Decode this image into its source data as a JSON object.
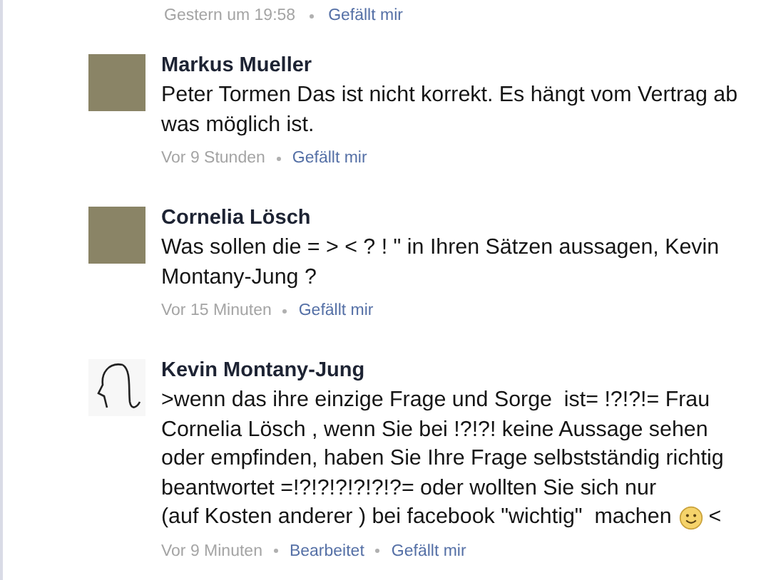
{
  "previous_meta": {
    "time": "Gestern um 19:58",
    "actions": [
      "Gefällt mir"
    ]
  },
  "comments": [
    {
      "author": "Markus Mueller",
      "avatar": {
        "kind": "photo"
      },
      "body": [
        [
          {
            "kind": "text",
            "text": "Peter Tormen Das ist nicht korrekt. Es hängt vom Vertrag ab was möglich ist."
          }
        ]
      ],
      "time": "Vor 9 Stunden",
      "actions": [
        "Gefällt mir"
      ]
    },
    {
      "author": "Cornelia Lösch",
      "avatar": {
        "kind": "photo"
      },
      "body": [
        [
          {
            "kind": "text",
            "text": "Was sollen die = > < ? ! \" in Ihren Sätzen aussagen, Kevin Montany-Jung ?"
          }
        ]
      ],
      "time": "Vor 15 Minuten",
      "actions": [
        "Gefällt mir"
      ]
    },
    {
      "author": "Kevin Montany-Jung",
      "avatar": {
        "kind": "sketch"
      },
      "body": [
        [
          {
            "kind": "text",
            "text": ">wenn das ihre einzige Frage und Sorge  ist= !?!?!= Frau Cornelia Lösch , wenn Sie bei !?!?! keine Aussage sehen oder empfinden, haben Sie Ihre Frage selbstständig richtig beantwortet =!?!?!?!?!?!?= oder wollten Sie sich nur"
          }
        ],
        [
          {
            "kind": "text",
            "text": "(auf Kosten anderer ) bei facebook \"wichtig\"  machen"
          },
          {
            "kind": "smiley"
          },
          {
            "kind": "text",
            "text": "<"
          }
        ]
      ],
      "time": "Vor 9 Minuten",
      "actions": [
        "Bearbeitet",
        "Gefällt mir"
      ]
    }
  ]
}
